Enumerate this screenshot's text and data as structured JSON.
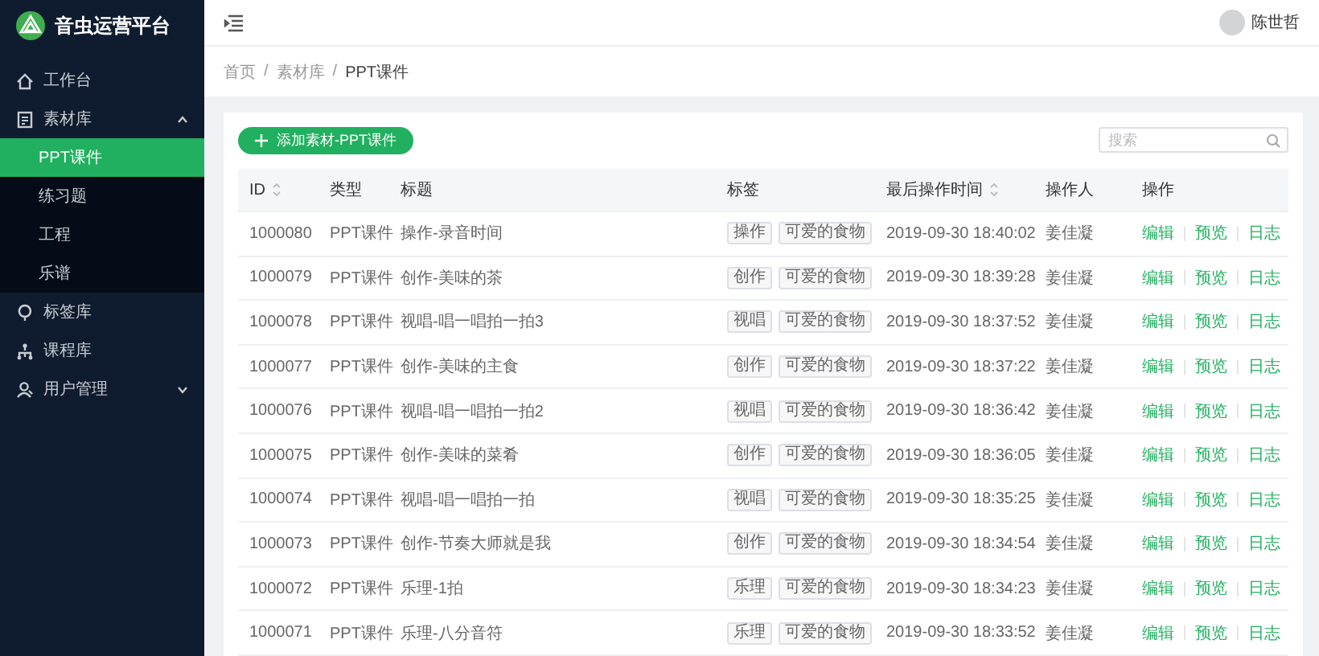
{
  "brand": {
    "title": "音虫运营平台"
  },
  "sidebar": {
    "items": [
      {
        "label": "工作台",
        "selected": false
      },
      {
        "label": "素材库",
        "expanded": true,
        "selected": false,
        "children": [
          {
            "label": "PPT课件",
            "selected": true
          },
          {
            "label": "练习题",
            "selected": false
          },
          {
            "label": "工程",
            "selected": false
          },
          {
            "label": "乐谱",
            "selected": false
          }
        ]
      },
      {
        "label": "标签库",
        "selected": false
      },
      {
        "label": "课程库",
        "selected": false
      },
      {
        "label": "用户管理",
        "expanded": false,
        "selected": false
      }
    ]
  },
  "header": {
    "user": "陈世哲"
  },
  "breadcrumb": {
    "items": [
      "首页",
      "素材库",
      "PPT课件"
    ],
    "separator": "/"
  },
  "toolbar": {
    "add_button": "添加素材-PPT课件",
    "search": {
      "placeholder": "搜索"
    }
  },
  "table": {
    "columns": [
      {
        "label": "ID",
        "sortable": true
      },
      {
        "label": "类型",
        "sortable": false
      },
      {
        "label": "标题",
        "sortable": false
      },
      {
        "label": "标签",
        "sortable": false
      },
      {
        "label": "最后操作时间",
        "sortable": true
      },
      {
        "label": "操作人",
        "sortable": false
      },
      {
        "label": "操作",
        "sortable": false
      }
    ],
    "rows": [
      {
        "id": "1000080",
        "type": "PPT课件",
        "title": "操作-录音时间",
        "tags": [
          "操作",
          "可爱的食物"
        ],
        "time": "2019-09-30 18:40:02",
        "operator": "姜佳凝",
        "actions": [
          "编辑",
          "预览",
          "日志"
        ]
      },
      {
        "id": "1000079",
        "type": "PPT课件",
        "title": "创作-美味的茶",
        "tags": [
          "创作",
          "可爱的食物"
        ],
        "time": "2019-09-30 18:39:28",
        "operator": "姜佳凝",
        "actions": [
          "编辑",
          "预览",
          "日志"
        ]
      },
      {
        "id": "1000078",
        "type": "PPT课件",
        "title": "视唱-唱一唱拍一拍3",
        "tags": [
          "视唱",
          "可爱的食物"
        ],
        "time": "2019-09-30 18:37:52",
        "operator": "姜佳凝",
        "actions": [
          "编辑",
          "预览",
          "日志"
        ]
      },
      {
        "id": "1000077",
        "type": "PPT课件",
        "title": "创作-美味的主食",
        "tags": [
          "创作",
          "可爱的食物"
        ],
        "time": "2019-09-30 18:37:22",
        "operator": "姜佳凝",
        "actions": [
          "编辑",
          "预览",
          "日志"
        ]
      },
      {
        "id": "1000076",
        "type": "PPT课件",
        "title": "视唱-唱一唱拍一拍2",
        "tags": [
          "视唱",
          "可爱的食物"
        ],
        "time": "2019-09-30 18:36:42",
        "operator": "姜佳凝",
        "actions": [
          "编辑",
          "预览",
          "日志"
        ]
      },
      {
        "id": "1000075",
        "type": "PPT课件",
        "title": "创作-美味的菜肴",
        "tags": [
          "创作",
          "可爱的食物"
        ],
        "time": "2019-09-30 18:36:05",
        "operator": "姜佳凝",
        "actions": [
          "编辑",
          "预览",
          "日志"
        ]
      },
      {
        "id": "1000074",
        "type": "PPT课件",
        "title": "视唱-唱一唱拍一拍",
        "tags": [
          "视唱",
          "可爱的食物"
        ],
        "time": "2019-09-30 18:35:25",
        "operator": "姜佳凝",
        "actions": [
          "编辑",
          "预览",
          "日志"
        ]
      },
      {
        "id": "1000073",
        "type": "PPT课件",
        "title": "创作-节奏大师就是我",
        "tags": [
          "创作",
          "可爱的食物"
        ],
        "time": "2019-09-30 18:34:54",
        "operator": "姜佳凝",
        "actions": [
          "编辑",
          "预览",
          "日志"
        ]
      },
      {
        "id": "1000072",
        "type": "PPT课件",
        "title": "乐理-1拍",
        "tags": [
          "乐理",
          "可爱的食物"
        ],
        "time": "2019-09-30 18:34:23",
        "operator": "姜佳凝",
        "actions": [
          "编辑",
          "预览",
          "日志"
        ]
      },
      {
        "id": "1000071",
        "type": "PPT课件",
        "title": "乐理-八分音符",
        "tags": [
          "乐理",
          "可爱的食物"
        ],
        "time": "2019-09-30 18:33:52",
        "operator": "姜佳凝",
        "actions": [
          "编辑",
          "预览",
          "日志"
        ]
      }
    ]
  }
}
